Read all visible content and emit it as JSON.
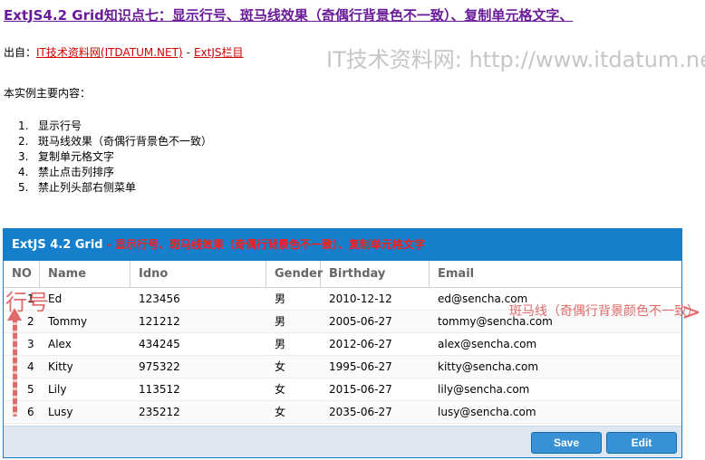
{
  "page": {
    "title": "ExtJS4.2 Grid知识点七：显示行号、斑马线效果（奇偶行背景色不一致）、复制单元格文字、"
  },
  "source": {
    "label": "出自：",
    "link1": "IT技术资料网(ITDATUM.NET)",
    "separator": "-",
    "link2": "ExtJS栏目"
  },
  "watermark": "IT技术资料网: http://www.itdatum.net",
  "intro": "本实例主要内容：",
  "features": [
    {
      "num": "1.",
      "text": "显示行号"
    },
    {
      "num": "2.",
      "text": "斑马线效果（奇偶行背景色不一致）"
    },
    {
      "num": "3.",
      "text": "复制单元格文字"
    },
    {
      "num": "4.",
      "text": "禁止点击列排序"
    },
    {
      "num": "5.",
      "text": "禁止列头部右侧菜单"
    }
  ],
  "grid": {
    "title": "ExtJS 4.2 Grid",
    "subtitle": " - 显示行号、斑马线效果（奇偶行背景色不一致）、复制单元格文字",
    "columns": [
      "NO",
      "Name",
      "Idno",
      "Gender",
      "Birthday",
      "Email"
    ],
    "rows": [
      [
        "1",
        "Ed",
        "123456",
        "男",
        "2010-12-12",
        "ed@sencha.com"
      ],
      [
        "2",
        "Tommy",
        "121212",
        "男",
        "2005-06-27",
        "tommy@sencha.com"
      ],
      [
        "3",
        "Alex",
        "434245",
        "男",
        "2012-06-27",
        "alex@sencha.com"
      ],
      [
        "4",
        "Kitty",
        "975322",
        "女",
        "1995-06-27",
        "kitty@sencha.com"
      ],
      [
        "5",
        "Lily",
        "113512",
        "女",
        "2015-06-27",
        "lily@sencha.com"
      ],
      [
        "6",
        "Lusy",
        "235212",
        "女",
        "2035-06-27",
        "lusy@sencha.com"
      ]
    ],
    "buttons": {
      "save": "Save",
      "edit": "Edit"
    }
  },
  "annotations": {
    "row_number": "行号",
    "zebra": "斑马线（奇偶行背景颜色不一致）",
    "chevron": ">"
  },
  "colors": {
    "accent": "#157fcc",
    "title": "#6a1b9a",
    "link": "#d40000",
    "annotation": "#e06b6b"
  }
}
